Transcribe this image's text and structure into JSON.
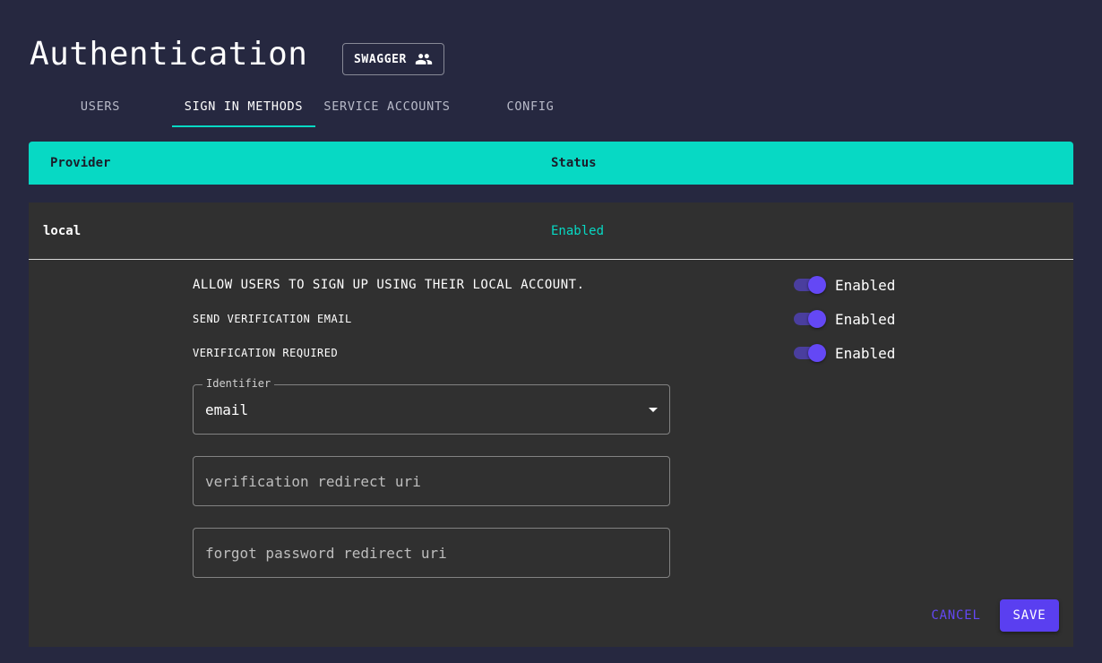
{
  "header": {
    "title": "Authentication",
    "swagger_label": "SWAGGER",
    "swagger_icon": "people-icon"
  },
  "tabs": [
    {
      "label": "USERS",
      "active": false
    },
    {
      "label": "SIGN IN METHODS",
      "active": true
    },
    {
      "label": "SERVICE ACCOUNTS",
      "active": false
    },
    {
      "label": "CONFIG",
      "active": false
    }
  ],
  "table": {
    "columns": [
      "Provider",
      "Status"
    ],
    "rows": [
      {
        "provider": "local",
        "status": "Enabled"
      }
    ]
  },
  "local_settings": {
    "allow_signup": {
      "label": "ALLOW USERS TO SIGN UP USING THEIR LOCAL ACCOUNT.",
      "value": "Enabled"
    },
    "send_verification": {
      "label": "SEND VERIFICATION EMAIL",
      "value": "Enabled"
    },
    "verification_required": {
      "label": "VERIFICATION REQUIRED",
      "value": "Enabled"
    },
    "identifier": {
      "label": "Identifier",
      "value": "email"
    },
    "verification_redirect": {
      "placeholder": "verification redirect uri",
      "value": ""
    },
    "forgot_password_redirect": {
      "placeholder": "forgot password redirect uri",
      "value": ""
    }
  },
  "actions": {
    "cancel_label": "CANCEL",
    "save_label": "SAVE"
  },
  "colors": {
    "background": "#262840",
    "panel": "#303030",
    "accent_teal": "#07d9c4",
    "accent_purple": "#6448f5"
  }
}
